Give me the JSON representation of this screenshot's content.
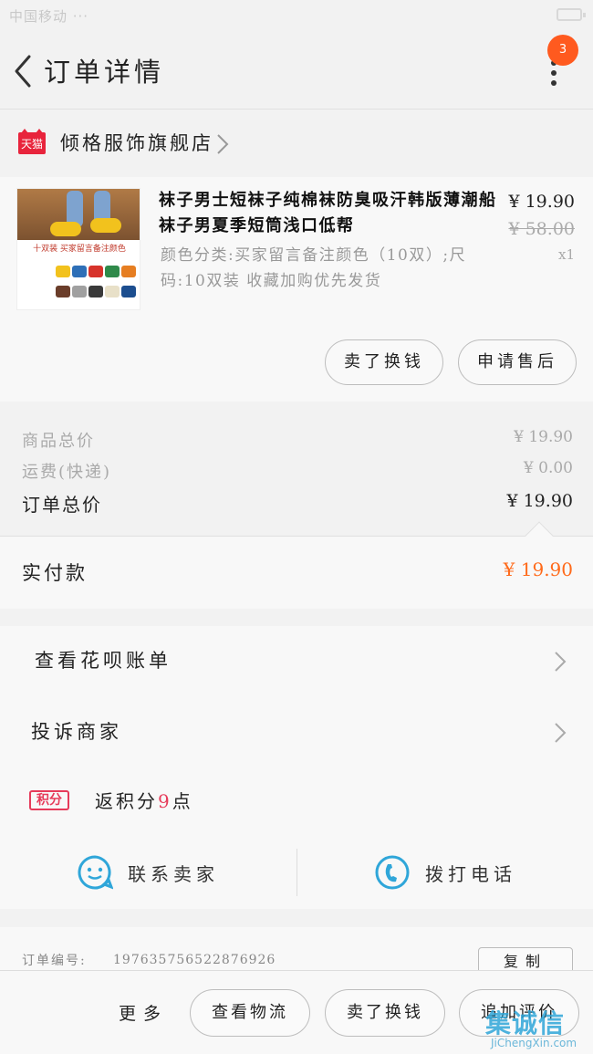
{
  "status_bar": {
    "left": "中国移动 ···",
    "center": "",
    "battery": ""
  },
  "header": {
    "title": "订单详情",
    "badge_count": "3"
  },
  "shop": {
    "badge": "天猫",
    "name": "倾格服饰旗舰店"
  },
  "product": {
    "title": "袜子男士短袜子纯棉袜防臭吸汗韩版薄潮船袜子男夏季短筒浅口低帮",
    "sku": "颜色分类:买家留言备注颜色（10双）;尺码:10双装 收藏加购优先发货",
    "price": "¥ 19.90",
    "original_price": "¥ 58.00",
    "quantity": "x1",
    "thumb_text": "十双装 买家留言备注颜色",
    "thumb_colors": [
      "#f2c21d",
      "#2e6fb7",
      "#d7332b",
      "#2f8a4a",
      "#e67e22",
      "#6a3d2a",
      "#a0a0a0",
      "#3a3a3a",
      "#e8e0c8",
      "#1c4e8f"
    ],
    "actions": {
      "refund": "卖了换钱",
      "after_sale": "申请售后"
    }
  },
  "totals": {
    "goods_label": "商品总价",
    "goods_value": "¥ 19.90",
    "shipping_label": "运费(快递)",
    "shipping_value": "¥ 0.00",
    "order_label": "订单总价",
    "order_value": "¥ 19.90",
    "paid_label": "实付款",
    "paid_value": "¥ 19.90"
  },
  "links": {
    "huabei": "查看花呗账单",
    "complain": "投诉商家",
    "points_icon": "积分",
    "points_prefix": "返积分",
    "points_value": "9",
    "points_suffix": "点",
    "contact_seller": "联系卖家",
    "call_phone": "拨打电话"
  },
  "order": {
    "number_label": "订单编号:",
    "number": "1976357565228769​26",
    "copy": "复制"
  },
  "bottom": {
    "more": "更多",
    "logistics": "查看物流",
    "sell": "卖了换钱",
    "review": "追加评价"
  },
  "watermark": {
    "main": "集诚信",
    "sub": "JiChengXin.com"
  },
  "colors": {
    "accent": "#ff6a1a",
    "tmall": "#e8243c",
    "icon_blue": "#2fa6d9"
  }
}
